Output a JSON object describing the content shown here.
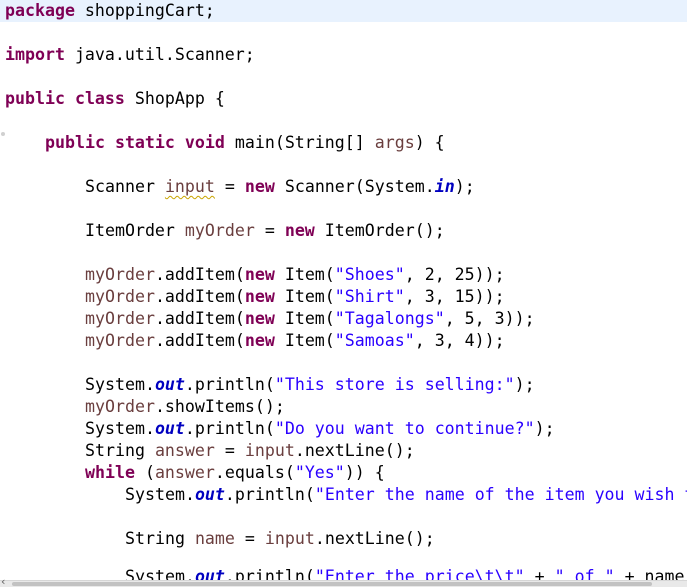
{
  "editor": {
    "lines": {
      "l1": {
        "kw": "package",
        "rest": " shoppingCart;"
      },
      "l2": {
        "kw": "import",
        "rest": " java.util.Scanner;"
      },
      "l3": {
        "kw1": "public",
        "kw2": "class",
        "name": " ShopApp {"
      },
      "l4": {
        "kw1": "public",
        "kw2": "static",
        "kw3": "void",
        "sig": " main(String[] ",
        "param": "args",
        "end": ") {"
      },
      "l5": {
        "type": "Scanner ",
        "var": "input",
        "eq": " = ",
        "kw": "new",
        "ctor": " Scanner(System.",
        "field": "in",
        "end": ");"
      },
      "l6": {
        "type": "ItemOrder ",
        "var": "myOrder",
        "eq": " = ",
        "kw": "new",
        "ctor": " ItemOrder();"
      },
      "l7": {
        "var": "myOrder",
        "call": ".addItem(",
        "kw": "new",
        "mid": " Item(",
        "str": "\"Shoes\"",
        "args": ", 2, 25));"
      },
      "l8": {
        "var": "myOrder",
        "call": ".addItem(",
        "kw": "new",
        "mid": " Item(",
        "str": "\"Shirt\"",
        "args": ", 3, 15));"
      },
      "l9": {
        "var": "myOrder",
        "call": ".addItem(",
        "kw": "new",
        "mid": " Item(",
        "str": "\"Tagalongs\"",
        "args": ", 5, 3));"
      },
      "l10": {
        "var": "myOrder",
        "call": ".addItem(",
        "kw": "new",
        "mid": " Item(",
        "str": "\"Samoas\"",
        "args": ", 3, 4));"
      },
      "l11": {
        "pre": "System.",
        "field": "out",
        "call": ".println(",
        "str": "\"This store is selling:\"",
        "end": ");"
      },
      "l12": {
        "var": "myOrder",
        "call": ".showItems();"
      },
      "l13": {
        "pre": "System.",
        "field": "out",
        "call": ".println(",
        "str": "\"Do you want to continue?\"",
        "end": ");"
      },
      "l14": {
        "type": "String ",
        "var": "answer",
        "eq": " = ",
        "var2": "input",
        "call": ".nextLine();"
      },
      "l15": {
        "kw": "while",
        "open": " (",
        "var": "answer",
        "call": ".equals(",
        "str": "\"Yes\"",
        "end": ")) {"
      },
      "l16": {
        "pre": "System.",
        "field": "out",
        "call": ".println(",
        "str": "\"Enter the name of the item you wish t"
      },
      "l17": {
        "type": "String ",
        "var": "name",
        "eq": " = ",
        "var2": "input",
        "call": ".nextLine();"
      },
      "l18": {
        "pre": "System.",
        "field": "out",
        "call": ".println(",
        "str": "\"Enter the price\\t\\t\"",
        "mid": " + ",
        "str2": "\" of \"",
        "end": " + name"
      }
    },
    "scrollbar": {
      "left_arrow": "‹"
    }
  },
  "colors": {
    "keyword": "#7f0055",
    "string": "#2a00ff",
    "local_variable": "#6a3e3e",
    "static_field": "#0000c0",
    "current_line": "#e8f2fe"
  }
}
